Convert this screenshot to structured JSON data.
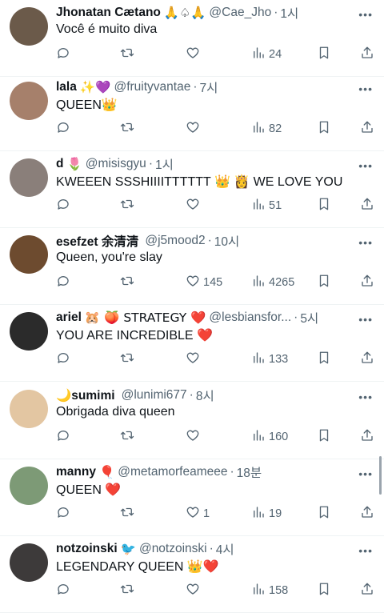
{
  "tweets": [
    {
      "name": "Jhonatan Cætano",
      "badge": "🙏♤🙏",
      "handle": "@Cae_Jho",
      "time": "1시",
      "text": "Você é muito diva",
      "replies": "",
      "retweets": "",
      "likes": "",
      "views": "24",
      "avatar_color": "#6b5a4a"
    },
    {
      "name": "lala",
      "badge": "✨💜",
      "handle": "@fruityvantae",
      "time": "7시",
      "text": "QUEEN👑",
      "replies": "",
      "retweets": "",
      "likes": "",
      "views": "82",
      "avatar_color": "#a6806b"
    },
    {
      "name": "d",
      "badge": "🌷",
      "handle": "@misisgyu",
      "time": "1시",
      "text": "KWEEEN SSSHIIIITTTTTT 👑 👸 WE LOVE YOU",
      "replies": "",
      "retweets": "",
      "likes": "",
      "views": "51",
      "avatar_color": "#8a7f7a"
    },
    {
      "name": "esefzet 余清清",
      "badge": "",
      "handle": "@j5mood2",
      "time": "10시",
      "text": "Queen, you're slay",
      "replies": "",
      "retweets": "",
      "likes": "145",
      "views": "4265",
      "avatar_color": "#6d4b2f"
    },
    {
      "name": "ariel",
      "badge": "🐹 🍑 STRATEGY ❤️",
      "handle": "@lesbiansfor...",
      "time": "5시",
      "text": "YOU ARE INCREDIBLE ❤️",
      "replies": "",
      "retweets": "",
      "likes": "",
      "views": "133",
      "avatar_color": "#2b2b2b"
    },
    {
      "name": "🌙sumimi",
      "badge": "",
      "handle": "@lunimi677",
      "time": "8시",
      "text": "Obrigada diva queen",
      "replies": "",
      "retweets": "",
      "likes": "",
      "views": "160",
      "avatar_color": "#e3c6a2"
    },
    {
      "name": "manny",
      "badge": "🎈",
      "handle": "@metamorfeameee",
      "time": "18분",
      "text": "QUEEN ❤️",
      "replies": "",
      "retweets": "",
      "likes": "1",
      "views": "19",
      "avatar_color": "#7d9a76"
    },
    {
      "name": "notzoinski",
      "badge": "🐦",
      "handle": "@notzoinski",
      "time": "4시",
      "text": "LEGENDARY QUEEN 👑❤️",
      "replies": "",
      "retweets": "",
      "likes": "",
      "views": "158",
      "avatar_color": "#3d3a3a"
    }
  ],
  "icons": {
    "reply": "reply-icon",
    "retweet": "retweet-icon",
    "like": "heart-icon",
    "views": "views-icon",
    "bookmark": "bookmark-icon",
    "share": "share-icon",
    "more": "more-icon"
  },
  "colors": {
    "muted": "#536471",
    "text": "#0f1419",
    "divider": "#eff3f4"
  }
}
